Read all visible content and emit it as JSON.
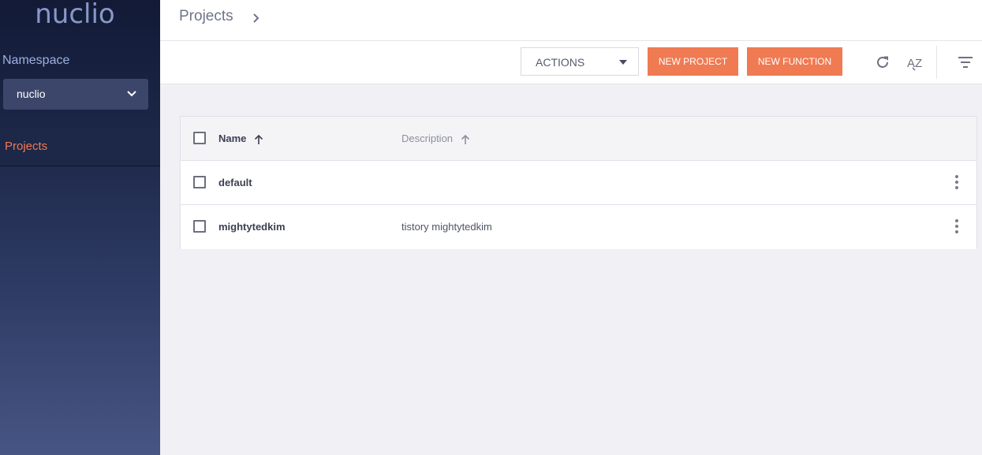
{
  "sidebar": {
    "logo": "nuclio",
    "namespace_label": "Namespace",
    "namespace_value": "nuclio",
    "nav_items": [
      {
        "label": "Projects",
        "active": true
      }
    ]
  },
  "header": {
    "breadcrumb": "Projects"
  },
  "toolbar": {
    "actions_label": "ACTIONS",
    "new_project_label": "NEW PROJECT",
    "new_function_label": "NEW FUNCTION",
    "sort_icon_text": "AZ"
  },
  "table": {
    "columns": [
      "Name",
      "Description"
    ],
    "rows": [
      {
        "name": "default",
        "description": ""
      },
      {
        "name": "mightytedkim",
        "description": "tistory mightytedkim"
      }
    ]
  },
  "colors": {
    "accent": "#f07a52",
    "sidebar_top": "#121a36",
    "sidebar_bottom": "#475584"
  }
}
